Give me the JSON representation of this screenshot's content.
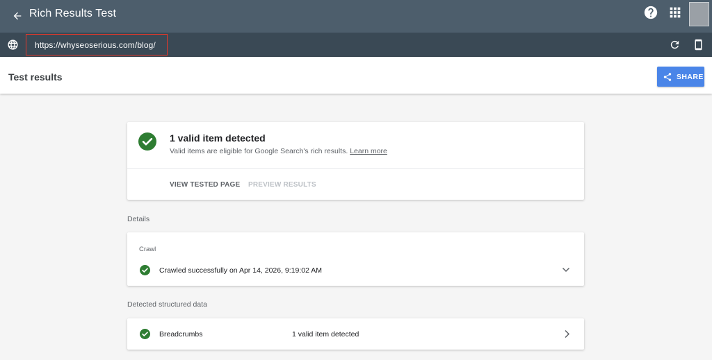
{
  "app": {
    "title": "Rich Results Test"
  },
  "url_bar": {
    "url": "https://whyseoserious.com/blog/"
  },
  "results_header": {
    "title": "Test results",
    "share_label": "SHARE"
  },
  "summary": {
    "title": "1 valid item detected",
    "description": "Valid items are eligible for Google Search's rich results.",
    "learn_more": "Learn more",
    "tabs": [
      "VIEW TESTED PAGE",
      "PREVIEW RESULTS"
    ]
  },
  "details": {
    "label": "Details",
    "crawl": {
      "heading": "Crawl",
      "status": "Crawled successfully on Apr 14, 2026, 9:19:02 AM"
    }
  },
  "structured_data": {
    "label": "Detected structured data",
    "items": [
      {
        "name": "Breadcrumbs",
        "status": "1 valid item detected"
      }
    ]
  },
  "colors": {
    "topbar": "#4d5e6c",
    "urlbar": "#3a4955",
    "success_green": "#2e7d32",
    "share_blue": "#4a85e8",
    "highlight_red": "#e3382b"
  },
  "icons": {
    "back": "arrow-left-icon",
    "help": "help-circle-icon",
    "apps": "apps-grid-icon",
    "globe": "globe-icon",
    "refresh": "refresh-icon",
    "device": "smartphone-icon",
    "share": "share-icon",
    "success": "check-circle-icon",
    "expand": "chevron-down-icon",
    "open": "chevron-right-icon"
  }
}
